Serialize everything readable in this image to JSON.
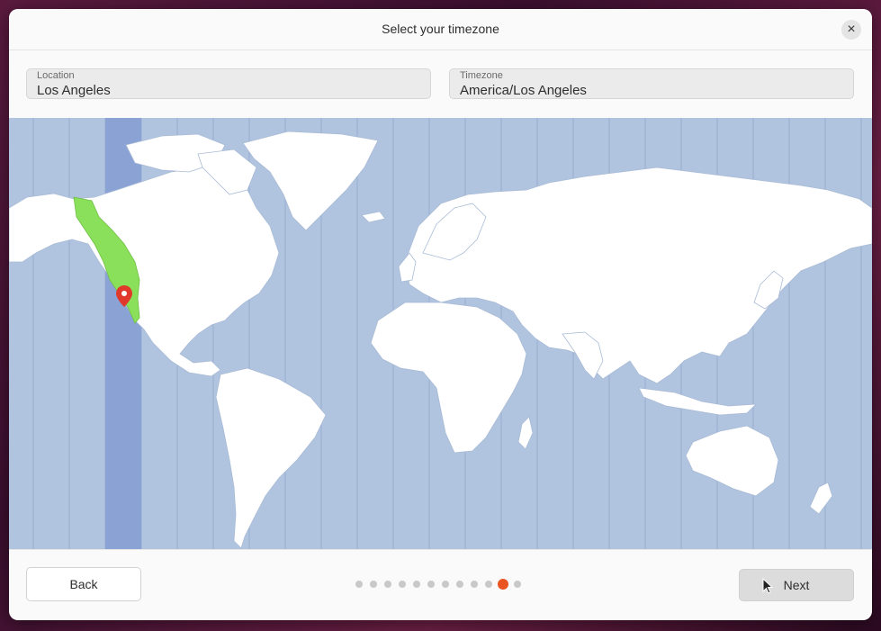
{
  "dialog": {
    "title": "Select your timezone",
    "close_label": "×"
  },
  "location": {
    "label": "Location",
    "value": "Los Angeles"
  },
  "timezone": {
    "label": "Timezone",
    "value": "America/Los Angeles"
  },
  "map": {
    "selected_zone_color": "#8aa3d4",
    "highlight_region_color": "#8ae05a",
    "marker_color": "#e0392b",
    "water_color": "#b0c4df",
    "land_color": "#ffffff"
  },
  "pagination": {
    "total": 12,
    "current": 11,
    "active_color": "#e95420"
  },
  "footer": {
    "back_label": "Back",
    "next_label": "Next"
  }
}
